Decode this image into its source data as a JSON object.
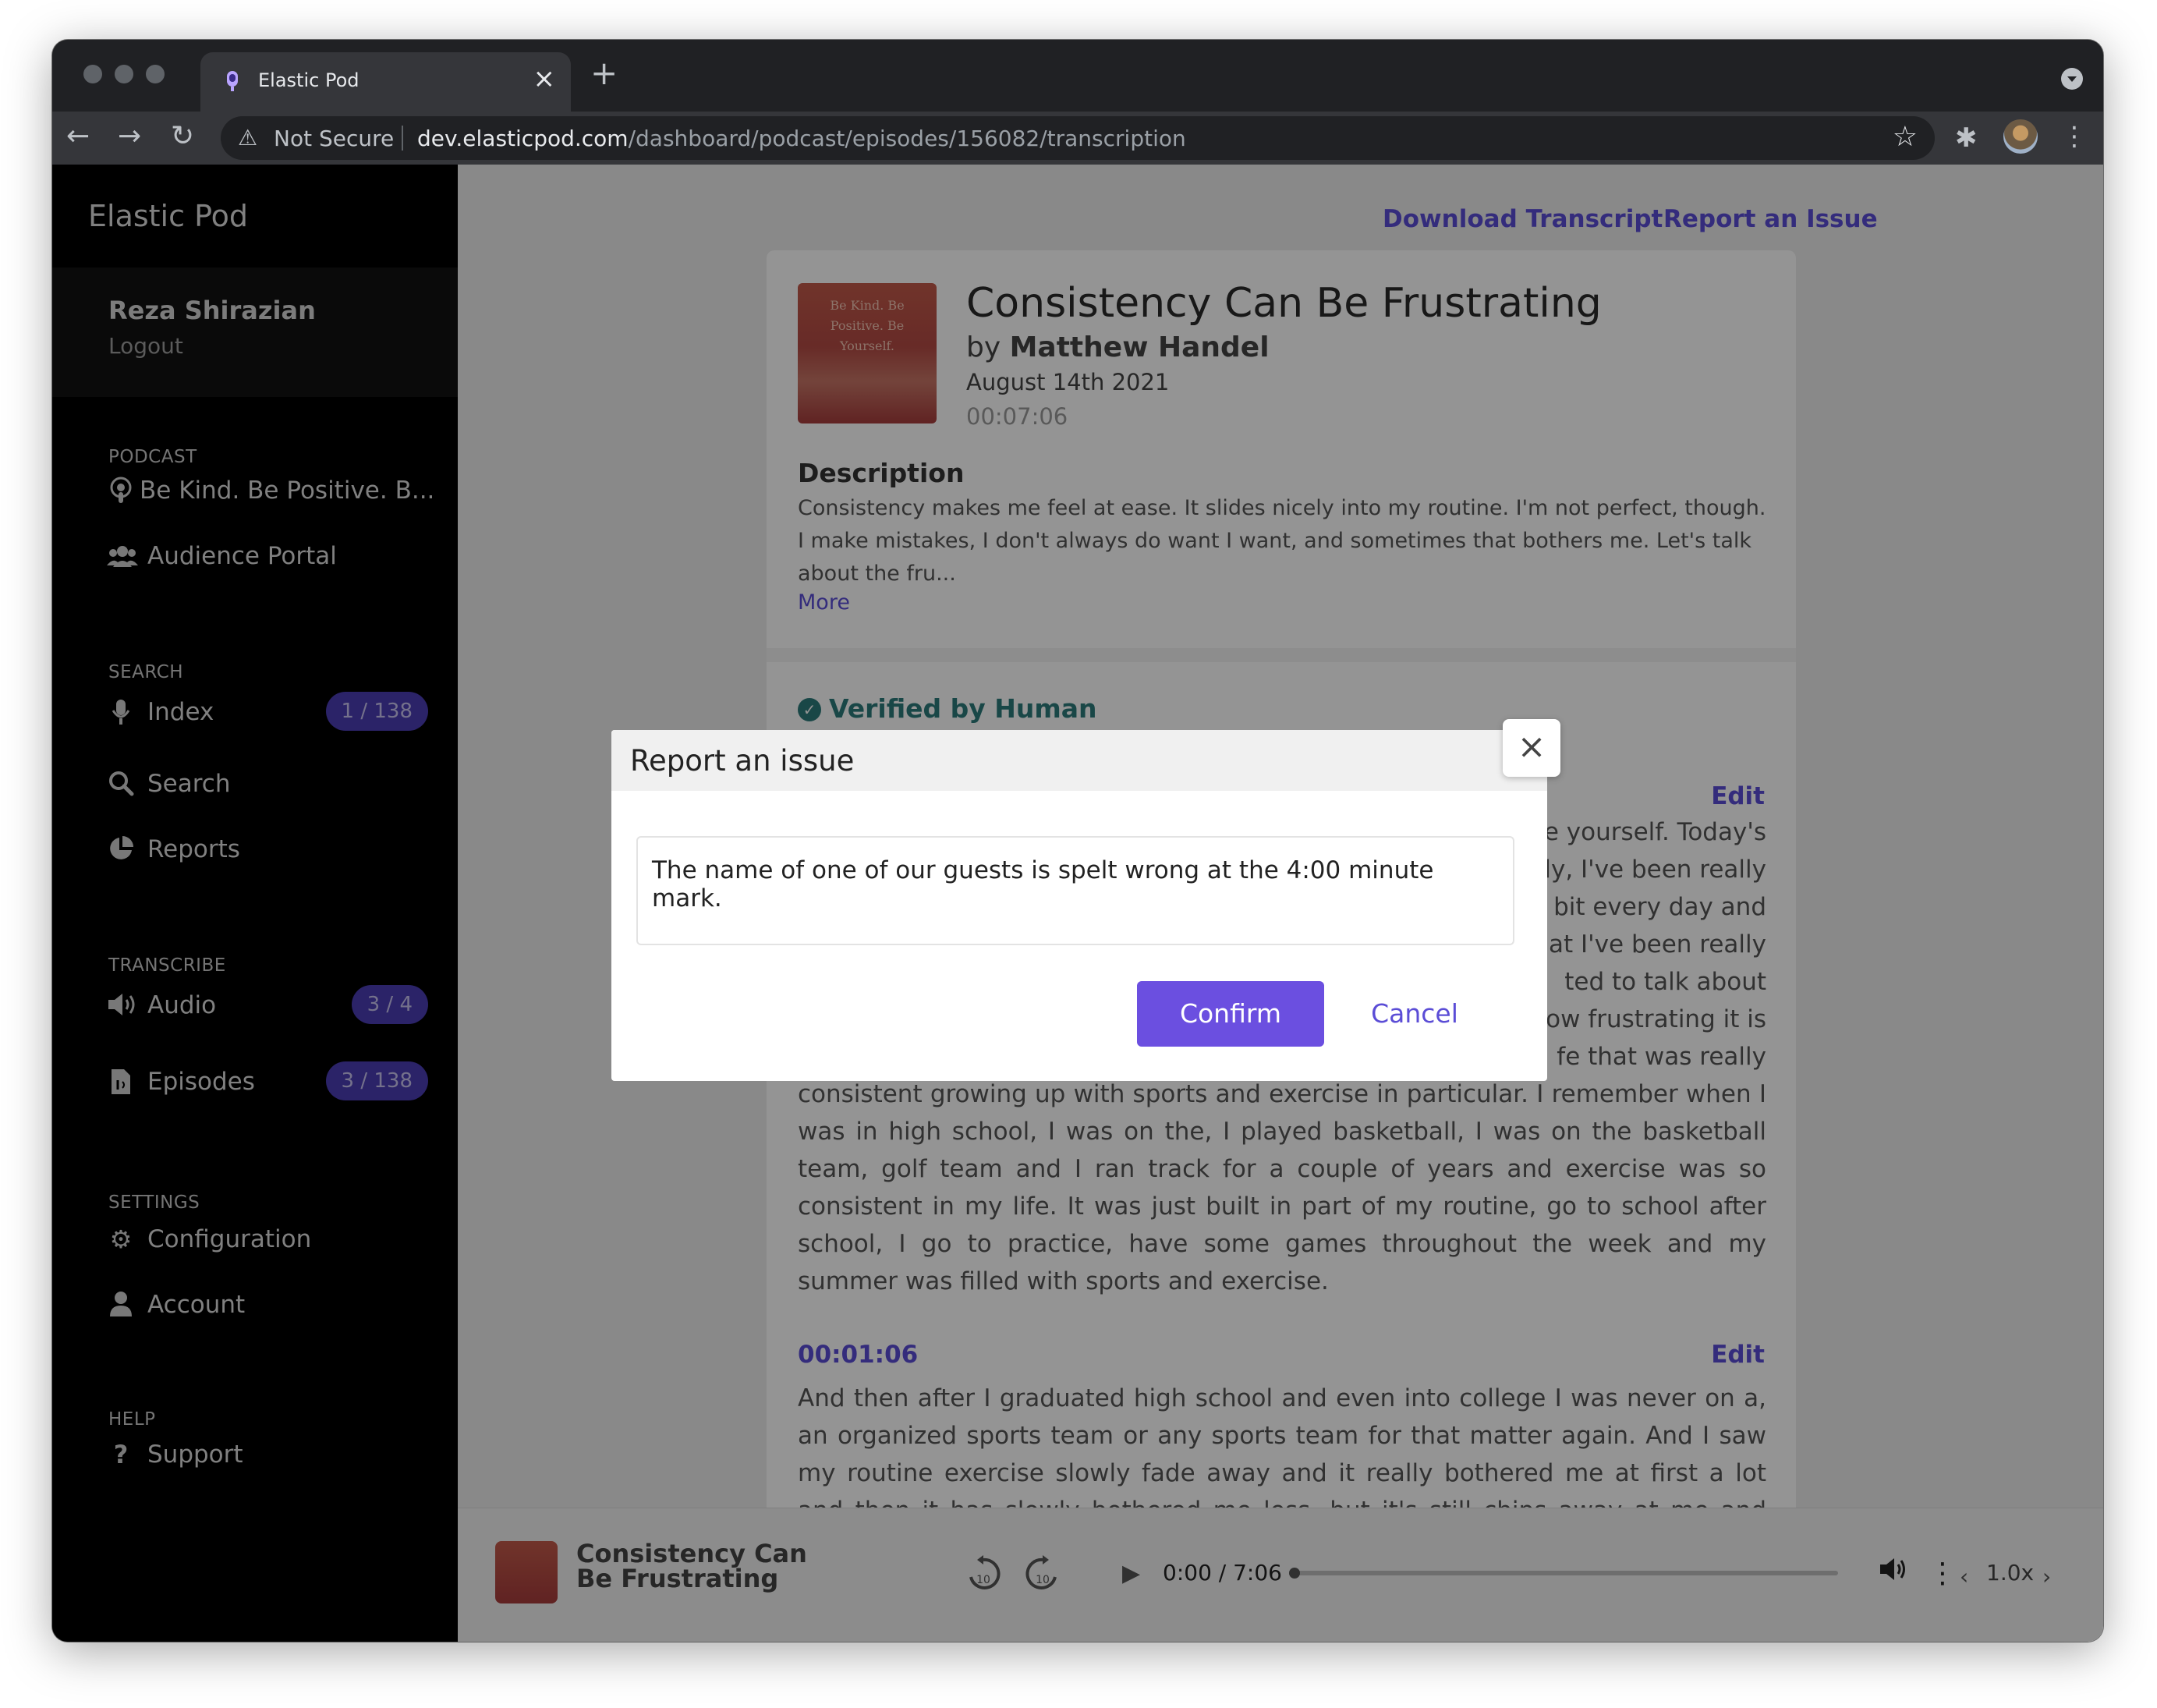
{
  "browser": {
    "tab_title": "Elastic Pod",
    "security_label": "Not Secure",
    "url_host": "dev.elasticpod.com",
    "url_path": "/dashboard/podcast/episodes/156082/transcription"
  },
  "sidebar": {
    "brand": "Elastic Pod",
    "user_name": "Reza Shirazian",
    "logout": "Logout",
    "sections": {
      "podcast": "PODCAST",
      "search": "SEARCH",
      "transcribe": "TRANSCRIBE",
      "settings": "SETTINGS",
      "help": "HELP"
    },
    "items": {
      "podcast_name": "Be Kind. Be Positive. B...",
      "audience_portal": "Audience Portal",
      "index": "Index",
      "index_badge": "1 / 138",
      "search": "Search",
      "reports": "Reports",
      "audio": "Audio",
      "audio_badge": "3 / 4",
      "episodes": "Episodes",
      "episodes_badge": "3 / 138",
      "configuration": "Configuration",
      "account": "Account",
      "support": "Support"
    }
  },
  "main": {
    "download_transcript": "Download Transcript",
    "report_issue": "Report an Issue",
    "cover_text": "Be Kind. Be Positive. Be Yourself.",
    "episode_title": "Consistency Can Be Frustrating",
    "by_prefix": "by",
    "author": "Matthew Handel",
    "date": "August 14th 2021",
    "duration": "00:07:06",
    "description_title": "Description",
    "description": "Consistency makes me feel at ease. It slides nicely into my routine. I'm not perfect, though. I make mistakes, I don't always do want I want, and sometimes that bothers me. Let's talk about the fru...",
    "more": "More",
    "verified": "Verified by Human",
    "edit": "Edit",
    "para1_right": [
      "e yourself. Today's",
      "tly, I've been really",
      "bit every day and",
      "hat I've been really",
      "ted to talk about",
      "how frustrating it is",
      "fe that was really"
    ],
    "para1_visible": "consistent growing up with sports and exercise in particular. I remember when I was in high school, I was on the, I played basketball, I was on the basketball team, golf team and I ran track for a couple of years and exercise was so consistent in my life. It was just built in part of my routine, go to school after school, I go to practice, have some games throughout the week and my summer was filled with sports and exercise.",
    "timestamp2": "00:01:06",
    "para2": "And then after I graduated high school and even into college I was never on a, an organized sports team or any sports team for that matter again. And I saw my routine exercise slowly fade away and it really bothered me at first a lot and then it has slowly bothered me less, but it's still chips away at me and bothers me and"
  },
  "player": {
    "title": "Consistency Can Be Frustrating",
    "time": "0:00 / 7:06",
    "progress": 0,
    "speed": "1.0x",
    "skip_back_seconds": "10",
    "skip_forward_seconds": "10"
  },
  "modal": {
    "title": "Report an issue",
    "input_value": "The name of one of our guests is spelt wrong at the 4:00 minute mark.",
    "confirm": "Confirm",
    "cancel": "Cancel"
  },
  "colors": {
    "accent": "#5b4dd6",
    "button": "#6b4fe0",
    "verified": "#2c7a7b",
    "sidebar_bg": "#000000"
  }
}
